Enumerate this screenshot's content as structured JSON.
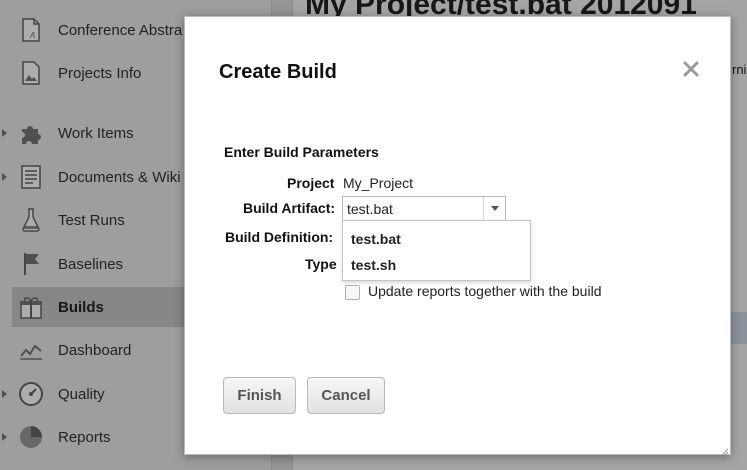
{
  "background": {
    "sidebar": {
      "items": [
        {
          "label": "Conference Abstra",
          "icon": "document-icon",
          "active": false,
          "expander": false
        },
        {
          "label": "Projects Info",
          "icon": "image-icon",
          "active": false,
          "expander": false
        },
        {
          "label": "Work Items",
          "icon": "puzzle-icon",
          "active": false,
          "expander": true
        },
        {
          "label": "Documents & Wiki",
          "icon": "documents-icon",
          "active": false,
          "expander": true
        },
        {
          "label": "Test Runs",
          "icon": "flask-icon",
          "active": false,
          "expander": false
        },
        {
          "label": "Baselines",
          "icon": "flag-icon",
          "active": false,
          "expander": false
        },
        {
          "label": "Builds",
          "icon": "gift-icon",
          "active": true,
          "expander": false
        },
        {
          "label": "Dashboard",
          "icon": "chart-icon",
          "active": false,
          "expander": false
        },
        {
          "label": "Quality",
          "icon": "gauge-icon",
          "active": false,
          "expander": true
        },
        {
          "label": "Reports",
          "icon": "pie-chart-icon",
          "active": false,
          "expander": true
        }
      ]
    },
    "main": {
      "title": "My Project/test.bat 2012091",
      "right_fragment": "rnir"
    }
  },
  "dialog": {
    "title": "Create Build",
    "close_icon": "close-icon",
    "section_title": "Enter Build Parameters",
    "fields": {
      "project_label": "Project",
      "project_value": "My_Project",
      "artifact_label": "Build Artifact:",
      "artifact_value": "test.bat",
      "definition_label": "Build Definition:",
      "type_label": "Type"
    },
    "artifact_options": [
      "test.bat",
      "test.sh"
    ],
    "update_reports_label": "Update reports together with the build",
    "update_reports_checked": false,
    "finish_label": "Finish",
    "cancel_label": "Cancel"
  }
}
